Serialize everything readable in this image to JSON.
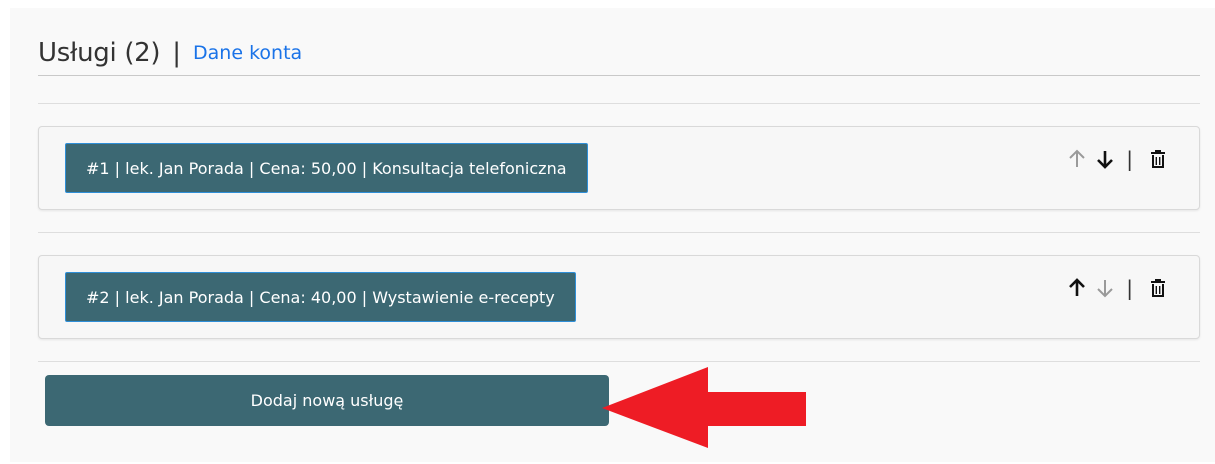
{
  "header": {
    "title": "Usługi (2)",
    "separator": "|",
    "account_link": "Dane konta"
  },
  "services": [
    {
      "label": "#1 | lek. Jan Porada | Cena: 50,00 | Konsultacja telefoniczna",
      "up_enabled": false,
      "down_enabled": true
    },
    {
      "label": "#2 | lek. Jan Porada | Cena: 40,00 | Wystawienie e-recepty",
      "up_enabled": true,
      "down_enabled": false
    }
  ],
  "controls": {
    "separator": "|",
    "up_icon": "arrow-up-icon",
    "down_icon": "arrow-down-icon",
    "delete_icon": "trash-icon"
  },
  "add_button": {
    "label": "Dodaj nową usługę"
  },
  "colors": {
    "button_bg": "#3c6873",
    "link": "#1a73e8",
    "annotation_arrow": "#ee1c25",
    "icon_enabled": "#111111",
    "icon_disabled": "#9a9a9a"
  }
}
